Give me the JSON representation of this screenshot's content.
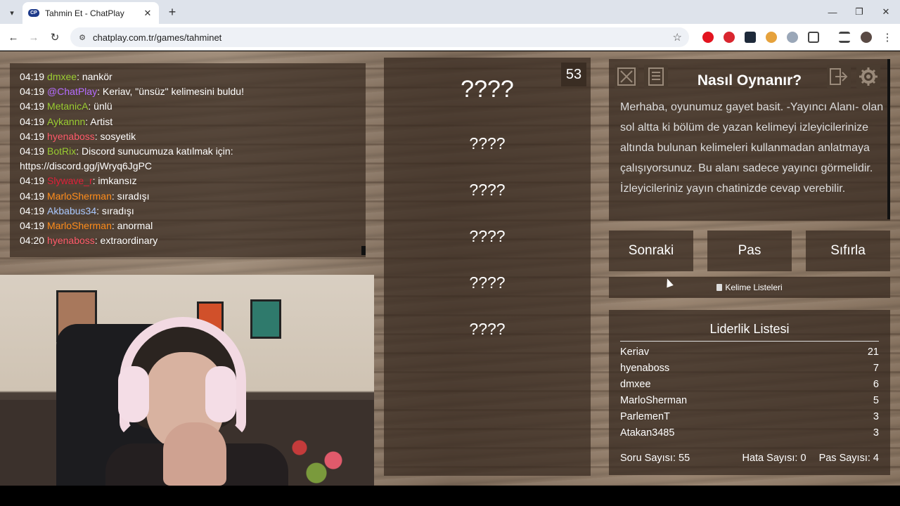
{
  "browser": {
    "tab_title": "Tahmin Et - ChatPlay",
    "tab_favicon": "CP",
    "url": "chatplay.com.tr/games/tahminet"
  },
  "chat": {
    "messages": [
      {
        "time": "04:19",
        "user": "dmxee",
        "color": "#9acd32",
        "sep": ":",
        "text": " nankör"
      },
      {
        "time": "04:19",
        "user": "@ChatPlay",
        "color": "#b36bff",
        "sep": ":",
        "text": " Keriav, \"ünsüz\" kelimesini buldu!"
      },
      {
        "time": "04:19",
        "user": "MetanicA",
        "color": "#9acd32",
        "sep": ":",
        "text": " ünlü"
      },
      {
        "time": "04:19",
        "user": "Aykannn",
        "color": "#9acd32",
        "sep": ":",
        "text": " Artist"
      },
      {
        "time": "04:19",
        "user": "hyenaboss",
        "color": "#ff5a6a",
        "sep": ":",
        "text": " sosyetik"
      },
      {
        "time": "04:19",
        "user": "BotRix",
        "color": "#9acd32",
        "sep": ":",
        "text": " Discord sunucumuza katılmak için:"
      },
      {
        "time": "",
        "user": "",
        "color": "#ffffff",
        "sep": "",
        "text": "https://discord.gg/jWryq6JgPC"
      },
      {
        "time": "04:19",
        "user": "Slywave_r",
        "color": "#e0203a",
        "sep": ":",
        "text": " imkansız"
      },
      {
        "time": "04:19",
        "user": "MarloSherman",
        "color": "#ff8c1a",
        "sep": ":",
        "text": " sıradışı"
      },
      {
        "time": "04:19",
        "user": "Akbabus34",
        "color": "#a9c8ff",
        "sep": ":",
        "text": " sıradışı"
      },
      {
        "time": "04:19",
        "user": "MarloSherman",
        "color": "#ff8c1a",
        "sep": ":",
        "text": " anormal"
      },
      {
        "time": "04:20",
        "user": "hyenaboss",
        "color": "#ff5a6a",
        "sep": ":",
        "text": " extraordinary"
      }
    ]
  },
  "game": {
    "timer": "53",
    "main_word": "????",
    "forbidden_words": [
      "????",
      "????",
      "????",
      "????",
      "????"
    ]
  },
  "how_to_play": {
    "title": "Nasıl Oynanır?",
    "text": "Merhaba, oyunumuz gayet basit. -Yayıncı Alanı- olan sol altta ki bölüm de yazan kelimeyi izleyicilerinize altında bulunan kelimeleri kullanmadan anlatmaya çalışıyorsunuz. Bu alanı sadece yayıncı görmelidir. İzleyicileriniz yayın chatinizde cevap verebilir."
  },
  "actions": {
    "next": "Sonraki",
    "pass": "Pas",
    "reset": "Sıfırla",
    "word_lists": "Kelime Listeleri"
  },
  "leaderboard": {
    "title": "Liderlik Listesi",
    "rows": [
      {
        "name": "Keriav",
        "score": "21"
      },
      {
        "name": "hyenaboss",
        "score": "7"
      },
      {
        "name": "dmxee",
        "score": "6"
      },
      {
        "name": "MarloSherman",
        "score": "5"
      },
      {
        "name": "ParlemenT",
        "score": "3"
      },
      {
        "name": "Atakan3485",
        "score": "3"
      }
    ],
    "question_count": "Soru Sayısı: 55",
    "error_count": "Hata Sayısı: 0",
    "pass_count": "Pas Sayısı: 4"
  }
}
